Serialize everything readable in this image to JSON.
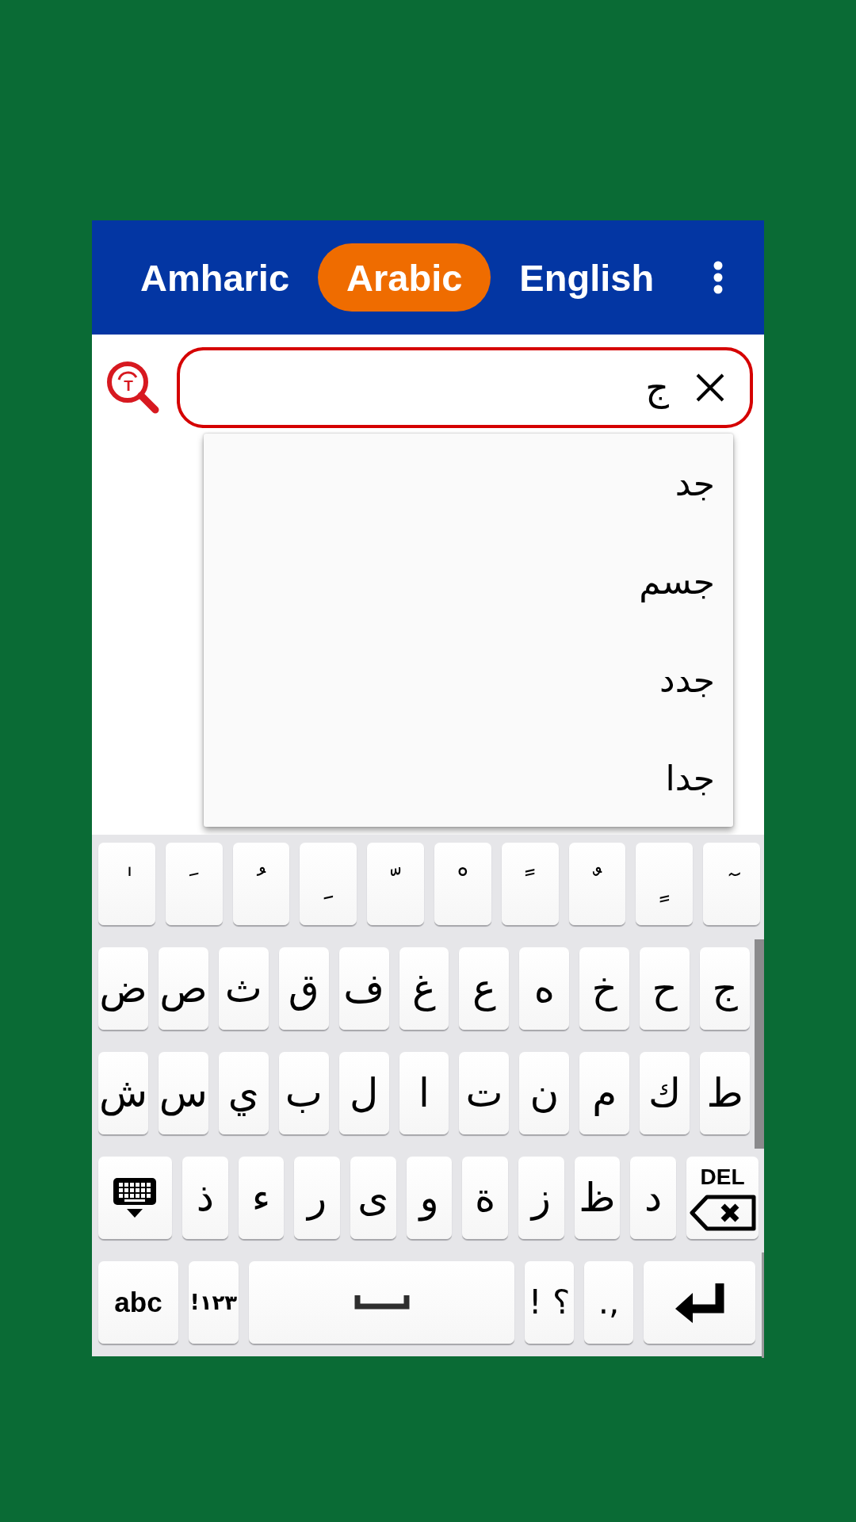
{
  "tabs": [
    {
      "label": "English",
      "selected": false
    },
    {
      "label": "Arabic",
      "selected": true
    },
    {
      "label": "Amharic",
      "selected": false
    }
  ],
  "search": {
    "icon_letter": "T",
    "value": "ج"
  },
  "suggestions": [
    "جد",
    "جسم",
    "جدد",
    "جدا"
  ],
  "keyboard": {
    "rows": [
      {
        "keys": [
          {
            "kind": "mark",
            "label": " ٓ"
          },
          {
            "kind": "mark",
            "label": "ﹴ"
          },
          {
            "kind": "mark",
            "label": "ﹲ"
          },
          {
            "kind": "mark",
            "label": "ﹰ"
          },
          {
            "kind": "mark",
            "label": "ﹾ"
          },
          {
            "kind": "mark",
            "label": "ﹼ"
          },
          {
            "kind": "mark",
            "label": "ﹺ"
          },
          {
            "kind": "mark",
            "label": "ﹸ"
          },
          {
            "kind": "mark",
            "label": "ﹶ"
          },
          {
            "kind": "mark",
            "label": " ٰ"
          }
        ]
      },
      {
        "keys": [
          {
            "kind": "letter",
            "label": "ج"
          },
          {
            "kind": "letter",
            "label": "ح"
          },
          {
            "kind": "letter",
            "label": "خ"
          },
          {
            "kind": "letter",
            "label": "ه"
          },
          {
            "kind": "letter",
            "label": "ع"
          },
          {
            "kind": "letter",
            "label": "غ"
          },
          {
            "kind": "letter",
            "label": "ف"
          },
          {
            "kind": "letter",
            "label": "ق"
          },
          {
            "kind": "letter",
            "label": "ث"
          },
          {
            "kind": "letter",
            "label": "ص"
          },
          {
            "kind": "letter",
            "label": "ض"
          }
        ]
      },
      {
        "keys": [
          {
            "kind": "letter",
            "label": "ط"
          },
          {
            "kind": "letter",
            "label": "ك"
          },
          {
            "kind": "letter",
            "label": "م"
          },
          {
            "kind": "letter",
            "label": "ن"
          },
          {
            "kind": "letter",
            "label": "ت"
          },
          {
            "kind": "letter",
            "label": "ا"
          },
          {
            "kind": "letter",
            "label": "ل"
          },
          {
            "kind": "letter",
            "label": "ب"
          },
          {
            "kind": "letter",
            "label": "ي"
          },
          {
            "kind": "letter",
            "label": "س"
          },
          {
            "kind": "letter",
            "label": "ش"
          }
        ]
      },
      {
        "keys": [
          {
            "kind": "delete",
            "label": "DEL"
          },
          {
            "kind": "letter",
            "label": "د"
          },
          {
            "kind": "letter",
            "label": "ظ"
          },
          {
            "kind": "letter",
            "label": "ز"
          },
          {
            "kind": "letter",
            "label": "ة"
          },
          {
            "kind": "letter",
            "label": "و"
          },
          {
            "kind": "letter",
            "label": "ى"
          },
          {
            "kind": "letter",
            "label": "ر"
          },
          {
            "kind": "letter",
            "label": "ء"
          },
          {
            "kind": "letter",
            "label": "ذ"
          },
          {
            "kind": "hide"
          }
        ]
      },
      {
        "keys": [
          {
            "kind": "enter"
          },
          {
            "kind": "punctuation",
            "label": ".,"
          },
          {
            "kind": "punctuation",
            "label": "! ؟"
          },
          {
            "kind": "space"
          },
          {
            "kind": "numbers",
            "label": "!١٢٣"
          },
          {
            "kind": "alphabet",
            "label": "abc"
          }
        ]
      }
    ]
  }
}
